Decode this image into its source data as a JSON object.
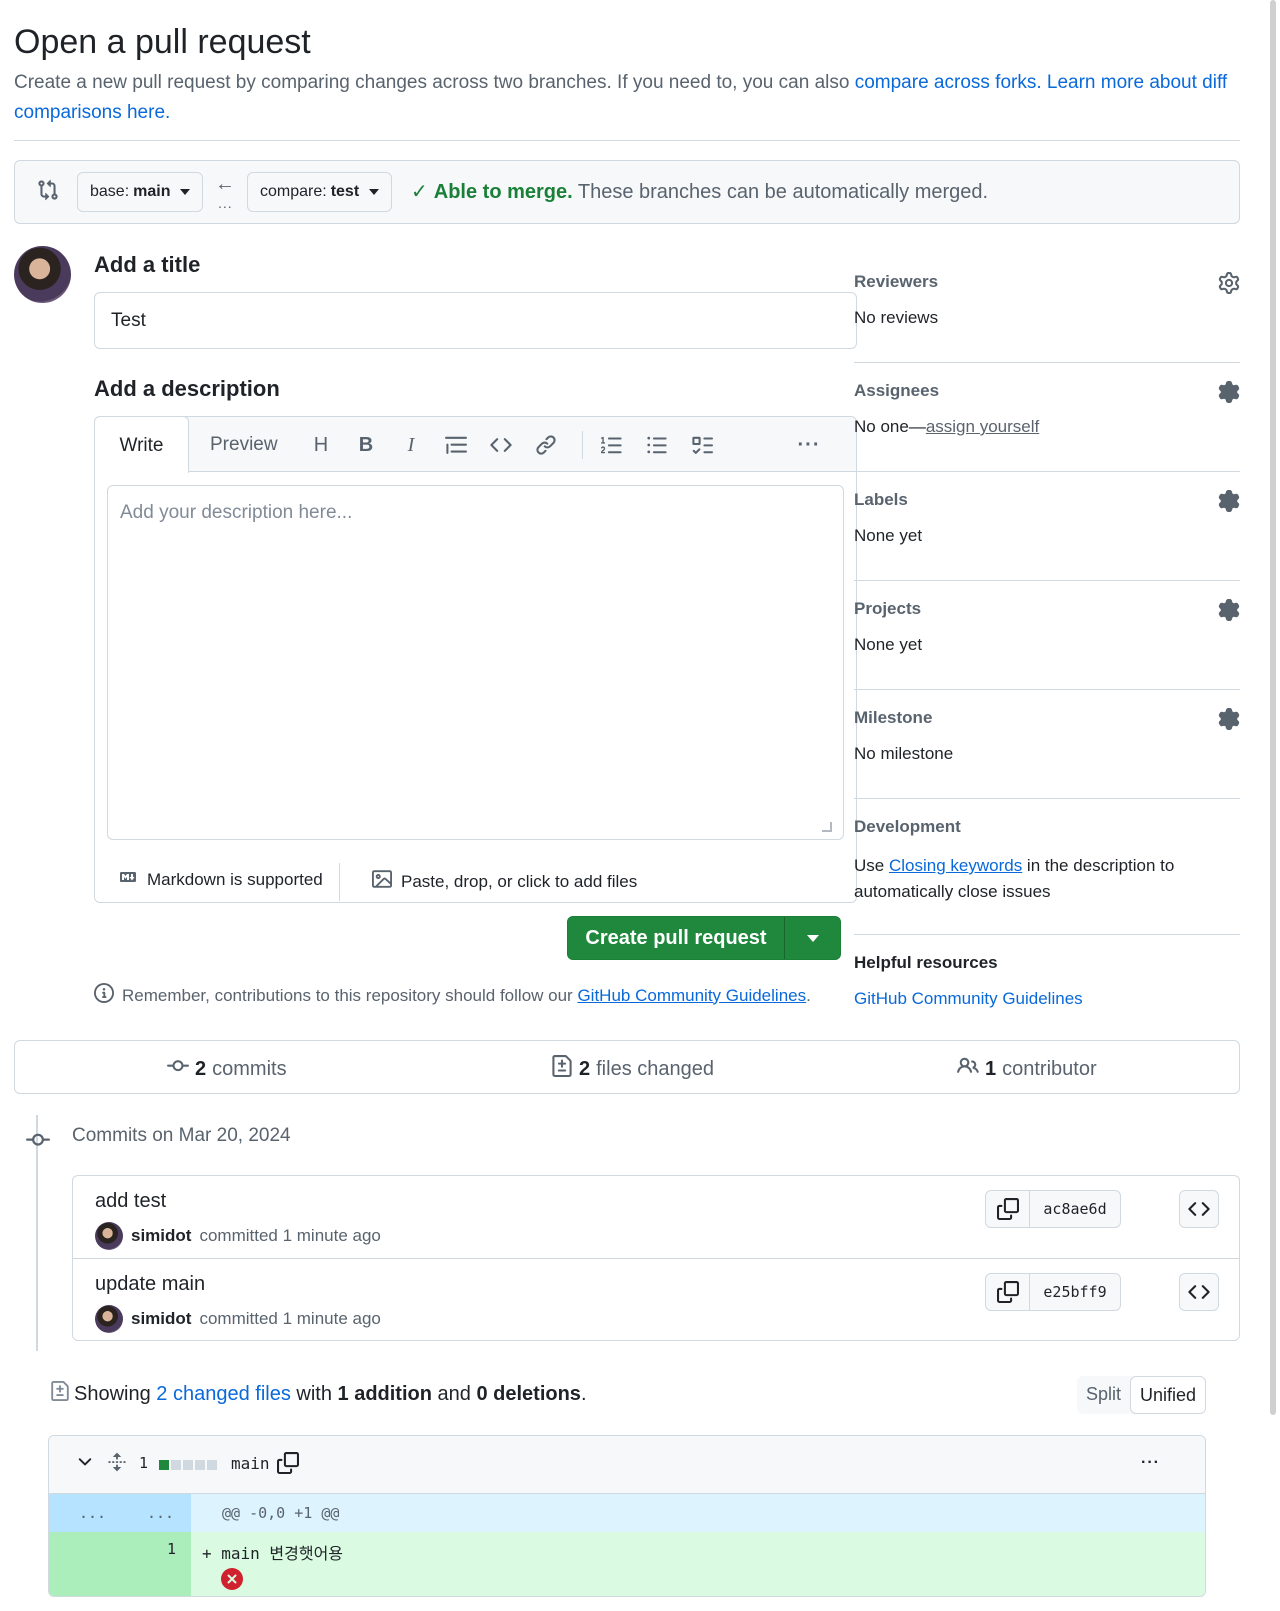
{
  "header": {
    "title": "Open a pull request",
    "subtitle_prefix": "Create a new pull request by comparing changes across two branches. If you need to, you can also ",
    "compare_forks_link": "compare across forks.",
    "learn_more_link": "Learn more about diff comparisons here."
  },
  "range": {
    "base_prefix": "base:",
    "base_branch": "main",
    "compare_prefix": "compare:",
    "compare_branch": "test",
    "arrow": "←",
    "dots": "...",
    "merge_ok": "Able to merge.",
    "merge_text": " These branches can be automatically merged."
  },
  "form": {
    "title_label": "Add a title",
    "title_value": "Test",
    "description_label": "Add a description",
    "tab_write": "Write",
    "tab_preview": "Preview",
    "description_placeholder": "Add your description here...",
    "markdown_note": "Markdown is supported",
    "attach_note": "Paste, drop, or click to add files",
    "create_button": "Create pull request",
    "remember_prefix": "Remember, contributions to this repository should follow our ",
    "remember_link": "GitHub Community Guidelines",
    "remember_suffix": "."
  },
  "toolbar": {
    "heading": "H",
    "bold": "B",
    "italic": "I",
    "more": "···"
  },
  "sidebar": {
    "reviewers": {
      "label": "Reviewers",
      "value": "No reviews"
    },
    "assignees": {
      "label": "Assignees",
      "value_prefix": "No one—",
      "value_link": "assign yourself"
    },
    "labels": {
      "label": "Labels",
      "value": "None yet"
    },
    "projects": {
      "label": "Projects",
      "value": "None yet"
    },
    "milestone": {
      "label": "Milestone",
      "value": "No milestone"
    },
    "development": {
      "label": "Development",
      "prefix": "Use ",
      "link": "Closing keywords",
      "suffix": " in the description to automatically close issues"
    },
    "helpful": {
      "label": "Helpful resources",
      "link": "GitHub Community Guidelines"
    }
  },
  "stats": {
    "commits_count": "2",
    "commits_label": "commits",
    "files_count": "2",
    "files_label": "files changed",
    "contributors_count": "1",
    "contributors_label": "contributor"
  },
  "commits": {
    "date_header": "Commits on Mar 20, 2024",
    "items": [
      {
        "title": "add test",
        "author": "simidot",
        "action": "committed 1 minute ago",
        "sha": "ac8ae6d"
      },
      {
        "title": "update main",
        "author": "simidot",
        "action": "committed 1 minute ago",
        "sha": "e25bff9"
      }
    ]
  },
  "diff_summary": {
    "prefix": "Showing ",
    "files_link": "2 changed files",
    "with": " with ",
    "additions": "1 addition",
    "and": " and ",
    "deletions": "0 deletions",
    "period": ".",
    "split": "Split",
    "unified": "Unified"
  },
  "file": {
    "change_count": "1",
    "name": "main",
    "additions_level": 1,
    "hunk_old": "...",
    "hunk_new": "...",
    "hunk_header": "@@ -0,0 +1 @@",
    "line_number": "1",
    "line_text": "+ main 변경햇어용",
    "more": "···"
  },
  "colors": {
    "accent": "#0969da",
    "success": "#1f883d",
    "merge_ok": "#1a7f37",
    "add_bg": "#dafbe1",
    "hunk_bg": "#ddf4ff",
    "danger": "#cf222e"
  }
}
